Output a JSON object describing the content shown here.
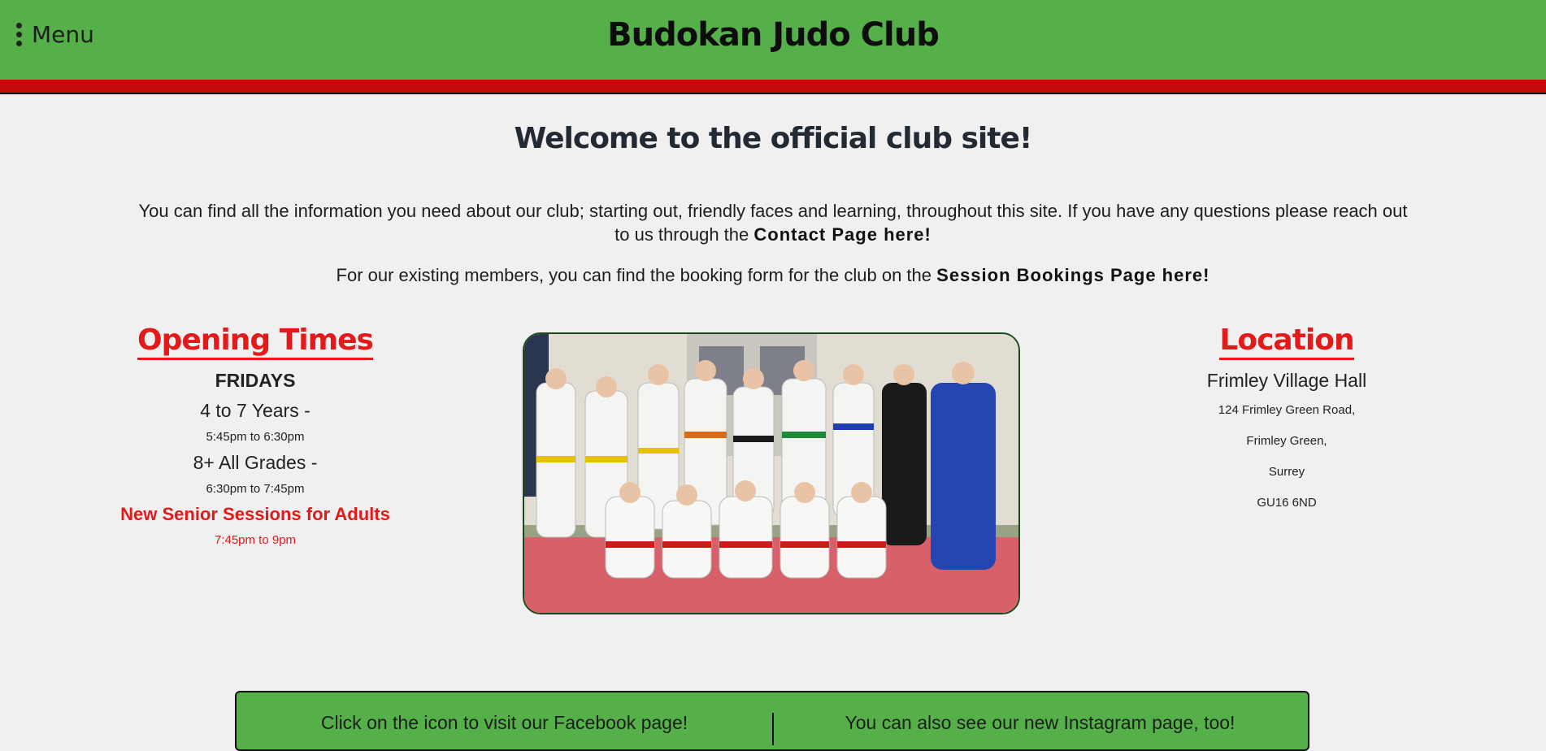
{
  "header": {
    "menu_label": "Menu",
    "site_title": "Budokan Judo Club"
  },
  "colors": {
    "header_green": "#55b04a",
    "band_red": "#c40a0a",
    "accent_red": "#e21a1a",
    "page_bg": "#f0f0f0"
  },
  "main": {
    "welcome": "Welcome to the official club site!",
    "intro_text": "You can find all the information you need about our club; starting out, friendly faces and learning, throughout this site. If you have any questions please reach out to us through the",
    "contact_link": "Contact Page here!",
    "bookings_text": "For our existing members, you can find the booking form for the club on the",
    "bookings_link": "Session Bookings Page here!"
  },
  "opening_times": {
    "title": "Opening Times",
    "day": "FRIDAYS",
    "sessions": [
      {
        "group": "4 to 7 Years -",
        "time": "5:45pm to 6:30pm"
      },
      {
        "group": "8+ All Grades -",
        "time": "6:30pm to 7:45pm"
      },
      {
        "group": "New Senior Sessions for Adults",
        "time": "7:45pm to 9pm"
      }
    ]
  },
  "location": {
    "title": "Location",
    "venue": "Frimley Village Hall",
    "address": [
      "124 Frimley Green Road,",
      "Frimley Green,",
      "Surrey",
      "GU16 6ND"
    ]
  },
  "social": {
    "facebook_text": "Click on the icon to visit our Facebook page!",
    "instagram_text": "You can also see our new Instagram page, too!"
  }
}
